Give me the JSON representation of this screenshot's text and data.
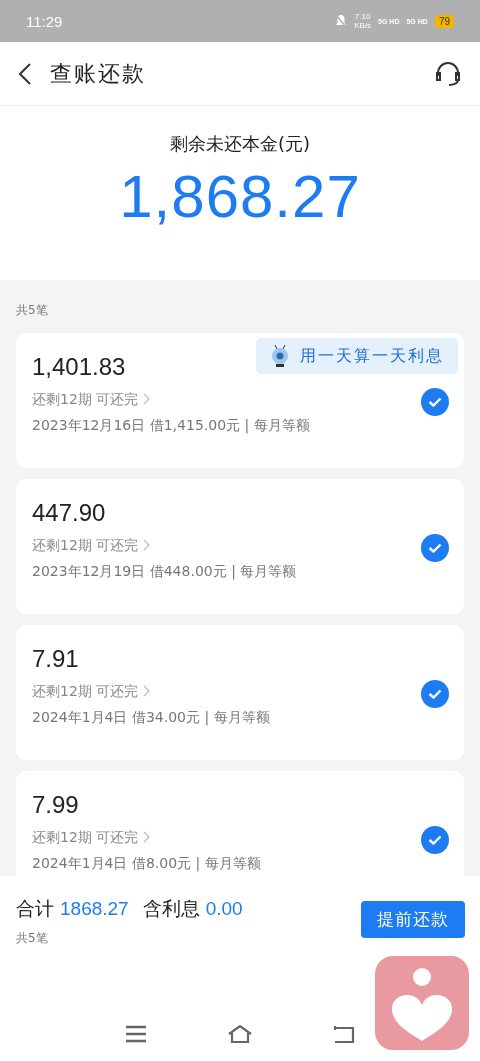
{
  "status_bar": {
    "time": "11:29",
    "net_speed": "7.10",
    "net_unit": "KB/s",
    "sim_1": "5G HD",
    "sim_2": "5G HD",
    "battery": "79"
  },
  "header": {
    "title": "查账还款"
  },
  "summary": {
    "label": "剩余未还本金(元)",
    "amount": "1,868.27"
  },
  "count_label": "共5笔",
  "loans": [
    {
      "amount": "1,401.83",
      "remaining": "还剩12期 可还完",
      "detail": "2023年12月16日 借1,415.00元 | 每月等额",
      "badge": "用一天算一天利息",
      "checked": true
    },
    {
      "amount": "447.90",
      "remaining": "还剩12期 可还完",
      "detail": "2023年12月19日 借448.00元 | 每月等额",
      "checked": true
    },
    {
      "amount": "7.91",
      "remaining": "还剩12期 可还完",
      "detail": "2024年1月4日 借34.00元 | 每月等额",
      "checked": true
    },
    {
      "amount": "7.99",
      "remaining": "还剩12期 可还完",
      "detail": "2024年1月4日 借8.00元 | 每月等额",
      "checked": true
    }
  ],
  "footer": {
    "total_label": "合计",
    "total": "1868.27",
    "interest_label": "含利息",
    "interest": "0.00",
    "count": "共5笔",
    "button": "提前还款"
  }
}
